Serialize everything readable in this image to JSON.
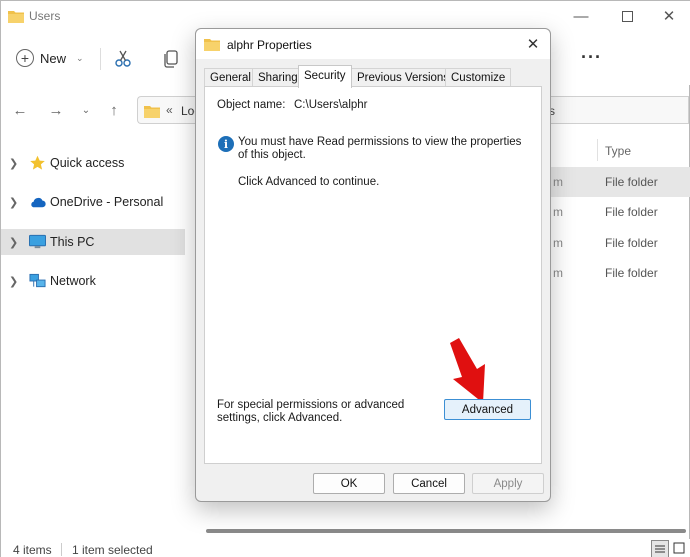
{
  "explorer": {
    "title": "Users",
    "toolbar": {
      "new_label": "New"
    },
    "address": {
      "text": "Loc",
      "chevron": "«"
    },
    "nav": [
      {
        "label": "Quick access",
        "icon": "star-icon"
      },
      {
        "label": "OneDrive - Personal",
        "icon": "cloud-icon"
      },
      {
        "label": "This PC",
        "icon": "monitor-icon",
        "selected": true
      },
      {
        "label": "Network",
        "icon": "network-icon"
      }
    ],
    "column_header": "Type",
    "rows": [
      {
        "date_fragment": "m",
        "type": "File folder"
      },
      {
        "date_fragment": "m",
        "type": "File folder"
      },
      {
        "date_fragment": "m",
        "type": "File folder"
      },
      {
        "date_fragment": "m",
        "type": "File folder"
      }
    ],
    "status": {
      "items": "4 items",
      "selected": "1 item selected"
    }
  },
  "dialog": {
    "title": "alphr Properties",
    "tabs": [
      "General",
      "Sharing",
      "Security",
      "Previous Versions",
      "Customize"
    ],
    "active_tab": "Security",
    "object_name_label": "Object name:",
    "object_name_value": "C:\\Users\\alphr",
    "info_message": "You must have Read permissions to view the properties of this object.",
    "continue_text": "Click Advanced to continue.",
    "special_text": "For special permissions or advanced settings, click Advanced.",
    "advanced_label": "Advanced",
    "ok_label": "OK",
    "cancel_label": "Cancel",
    "apply_label": "Apply"
  },
  "colors": {
    "accent": "#3c8fd4",
    "annotation_arrow": "#e01010",
    "folder": "#f0c14b"
  }
}
